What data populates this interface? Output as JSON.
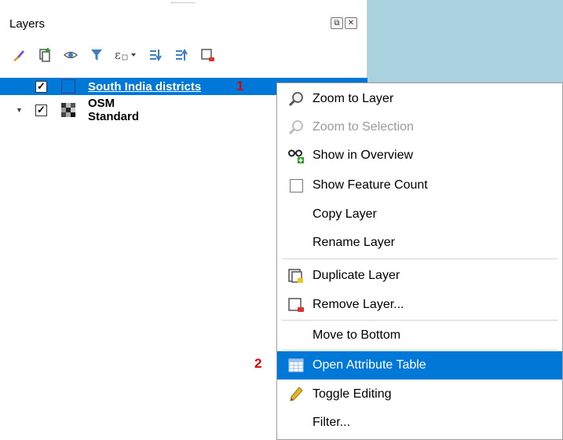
{
  "panel": {
    "title": "Layers",
    "float_icon": "float-icon",
    "close_icon": "close-icon"
  },
  "toolbar": [
    {
      "icon": "style-brush-icon"
    },
    {
      "icon": "add-group-icon"
    },
    {
      "icon": "visibility-eye-icon"
    },
    {
      "icon": "filter-funnel-icon"
    },
    {
      "icon": "expression-filter-icon"
    },
    {
      "icon": "expand-all-icon"
    },
    {
      "icon": "collapse-all-icon"
    },
    {
      "icon": "remove-layer-icon"
    }
  ],
  "layers": [
    {
      "name": "South India districts",
      "checked": "✓",
      "selected": true
    },
    {
      "name": "OSM Standard",
      "checked": "✓",
      "selected": false
    }
  ],
  "steps": {
    "one": "1",
    "two": "2"
  },
  "menu": {
    "zoom_to_layer": "Zoom to Layer",
    "zoom_to_selection": "Zoom to Selection",
    "show_in_overview": "Show in Overview",
    "show_feature_count": "Show Feature Count",
    "copy_layer": "Copy Layer",
    "rename_layer": "Rename Layer",
    "duplicate_layer": "Duplicate Layer",
    "remove_layer": "Remove Layer...",
    "move_to_bottom": "Move to Bottom",
    "open_attribute_table": "Open Attribute Table",
    "toggle_editing": "Toggle Editing",
    "filter": "Filter..."
  },
  "colors": {
    "selection": "#0078d7",
    "map_background": "#aad3df",
    "step_marker": "#e00000"
  }
}
